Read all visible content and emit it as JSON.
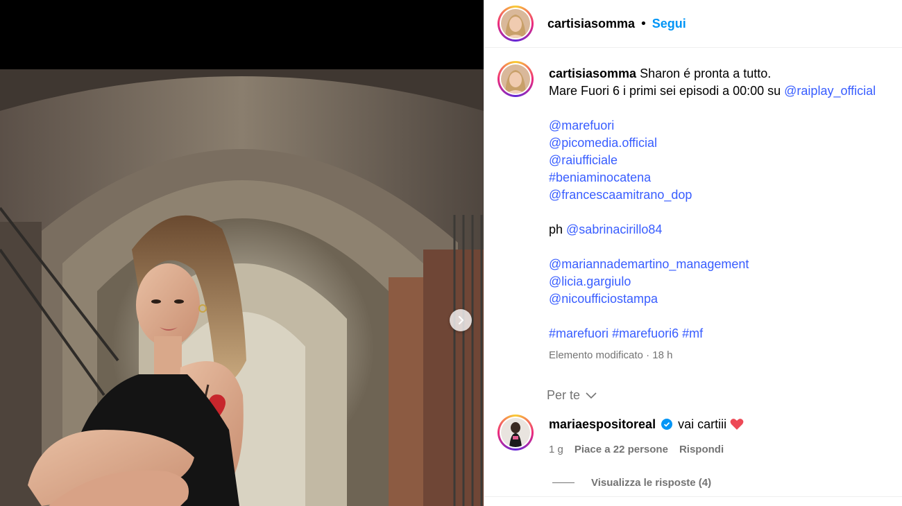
{
  "post": {
    "author": "cartisiasomma",
    "follow_label": "Segui",
    "separator": "•"
  },
  "caption": {
    "username": "cartisiasomma",
    "line1": "Sharon é pronta a tutto.",
    "line2_text": "Mare Fuori 6 i primi sei episodi a 00:00 su ",
    "line2_mention": "@raiplay_official",
    "mentions_group1": [
      "@marefuori",
      "@picomedia.official",
      "@raiufficiale",
      "#beniaminocatena",
      "@francescaamitrano_dop"
    ],
    "ph_label": "ph ",
    "ph_mention": "@sabrinacirillo84",
    "mentions_group2": [
      "@mariannademartino_management",
      "@licia.gargiulo",
      "@nicoufficiostampa"
    ],
    "hashtags": [
      "#marefuori",
      "#marefuori6",
      "#mf"
    ],
    "edited_label": "Elemento modificato · 18 h"
  },
  "for_you": {
    "label": "Per te",
    "icon": "chevron-down-icon"
  },
  "comment": {
    "username": "mariaespositoreal",
    "verified_icon": "verified-badge-icon",
    "text": "vai cartiii",
    "emoji_icon": "heart-icon",
    "time": "1 g",
    "likes": "Piace a 22 persone",
    "reply_label": "Rispondi",
    "view_replies": "Visualizza le risposte (4)"
  },
  "colors": {
    "link": "#385dff",
    "follow": "#0095f6",
    "muted": "#737373",
    "heart": "#ed4956",
    "verified": "#0095f6"
  }
}
